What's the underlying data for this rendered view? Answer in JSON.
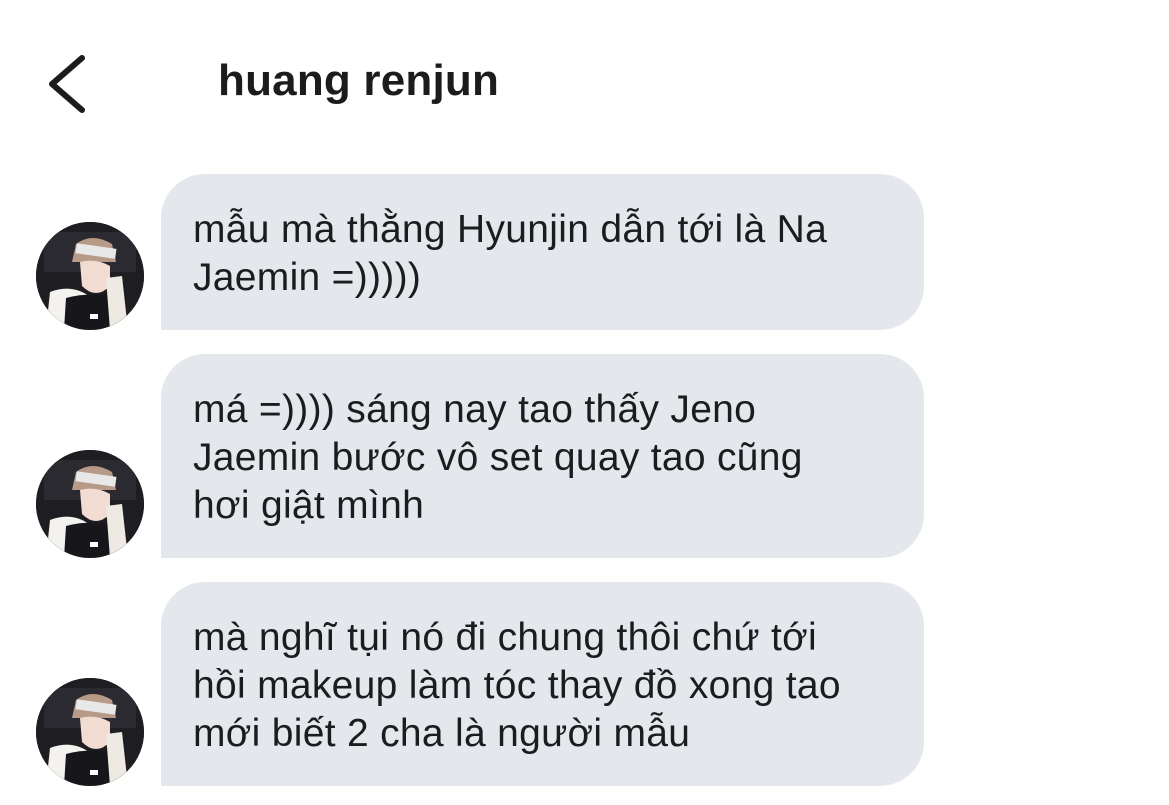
{
  "header": {
    "title": "huang renjun",
    "back_icon": "chevron-left-icon"
  },
  "colors": {
    "bubble_background": "#e4e8ed",
    "text": "#1c1c1e",
    "background": "#ffffff"
  },
  "messages": [
    {
      "sender": "huang renjun",
      "avatar_icon": "avatar-photo",
      "text": "mẫu mà thằng Hyunjin dẫn tới là Na\nJaemin =)))))"
    },
    {
      "sender": "huang renjun",
      "avatar_icon": "avatar-photo",
      "text": "má =)))) sáng nay tao thấy Jeno\nJaemin bước vô set quay tao cũng\nhơi giật mình"
    },
    {
      "sender": "huang renjun",
      "avatar_icon": "avatar-photo",
      "text": "mà nghĩ tụi nó đi chung thôi chứ tới\nhồi makeup làm tóc thay đồ xong tao\nmới biết 2 cha là người mẫu"
    }
  ]
}
